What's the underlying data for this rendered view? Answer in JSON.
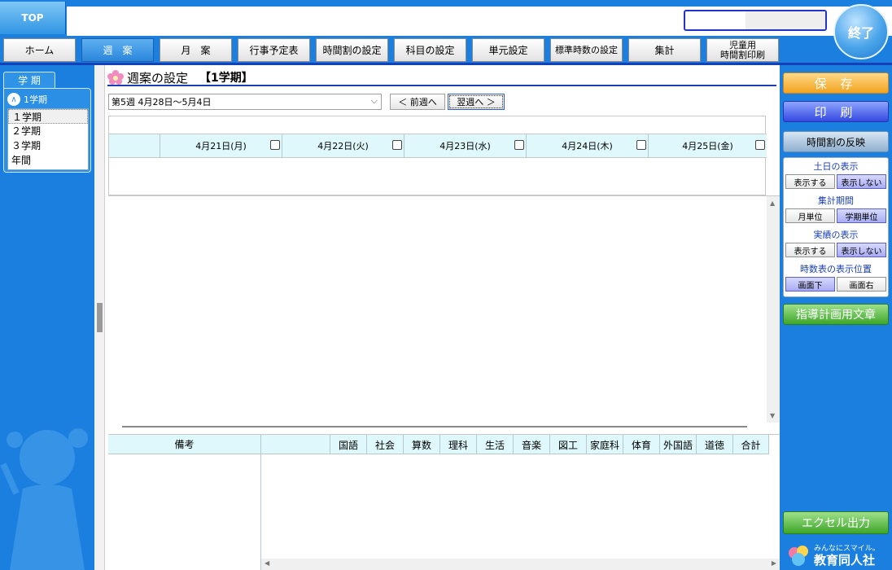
{
  "header": {
    "top_label": "TOP",
    "exit_label": "終了"
  },
  "nav": {
    "items": [
      {
        "label": "ホーム"
      },
      {
        "label": "週　案"
      },
      {
        "label": "月　案"
      },
      {
        "label": "行事予定表"
      },
      {
        "label": "時間割の設定"
      },
      {
        "label": "科目の設定"
      },
      {
        "label": "単元設定"
      },
      {
        "label": "標準時数の設定"
      },
      {
        "label": "集計"
      },
      {
        "label": "児童用\n時間割印刷"
      }
    ],
    "active": "週　案"
  },
  "sidebar": {
    "tab_label": "学 期",
    "selected_term": "1学期",
    "terms": [
      "１学期",
      "２学期",
      "３学期",
      "年間"
    ]
  },
  "main": {
    "title": "週案の設定",
    "term_badge": "【1学期】",
    "week_select": "第5週 4月28日～5月4日",
    "prev_label": "＜ 前週へ",
    "next_label": "翌週へ ＞",
    "days": [
      "4月21日(月)",
      "4月22日(火)",
      "4月23日(水)",
      "4月24日(木)",
      "4月25日(金)"
    ],
    "notes_label": "備考",
    "subjects": [
      "国語",
      "社会",
      "算数",
      "理科",
      "生活",
      "音楽",
      "図工",
      "家庭科",
      "体育",
      "外国語",
      "道徳",
      "合計"
    ]
  },
  "right": {
    "save_label": "保 存",
    "print_label": "印 刷",
    "reflect_label": "時間割の反映",
    "weekend_label": "土日の表示",
    "weekend_show": "表示する",
    "weekend_hide": "表示しない",
    "period_label": "集計期間",
    "period_month": "月単位",
    "period_term": "学期単位",
    "actual_label": "実績の表示",
    "actual_show": "表示する",
    "actual_hide": "表示しない",
    "hours_pos_label": "時数表の表示位置",
    "hours_pos_bottom": "画面下",
    "hours_pos_right": "画面右",
    "guide_label": "指導計画用文章",
    "excel_label": "エクセル出力",
    "logo_tagline": "みんなにスマイル。",
    "logo_name": "教育同人社"
  },
  "colors": {
    "accent": "#1a7fdf",
    "header_cell": "#dff8fb",
    "title_rule": "#1a3fb0"
  }
}
